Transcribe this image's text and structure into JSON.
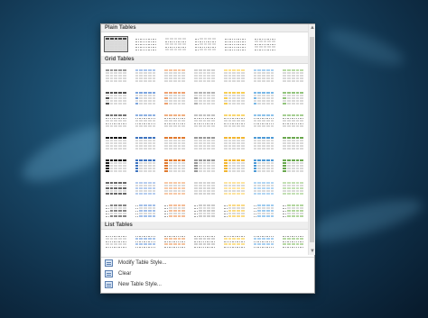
{
  "gallery": {
    "sections": {
      "plain": "Plain Tables",
      "grid": "Grid Tables",
      "list": "List Tables"
    },
    "commands": [
      {
        "label": "Modify Table Style...",
        "icon": "modify-table-style-icon"
      },
      {
        "label": "Clear",
        "icon": "clear-table-icon"
      },
      {
        "label": "New Table Style...",
        "icon": "new-table-style-icon"
      }
    ]
  },
  "colors": {
    "accent_black": "#1a1a1a",
    "accent_blue": "#3f74bf",
    "accent_orange": "#e07a2f",
    "accent_gray": "#9a9a9a",
    "accent_gold": "#f2b632",
    "accent_lightblue": "#4e9ad6",
    "accent_green": "#6aa84f"
  }
}
